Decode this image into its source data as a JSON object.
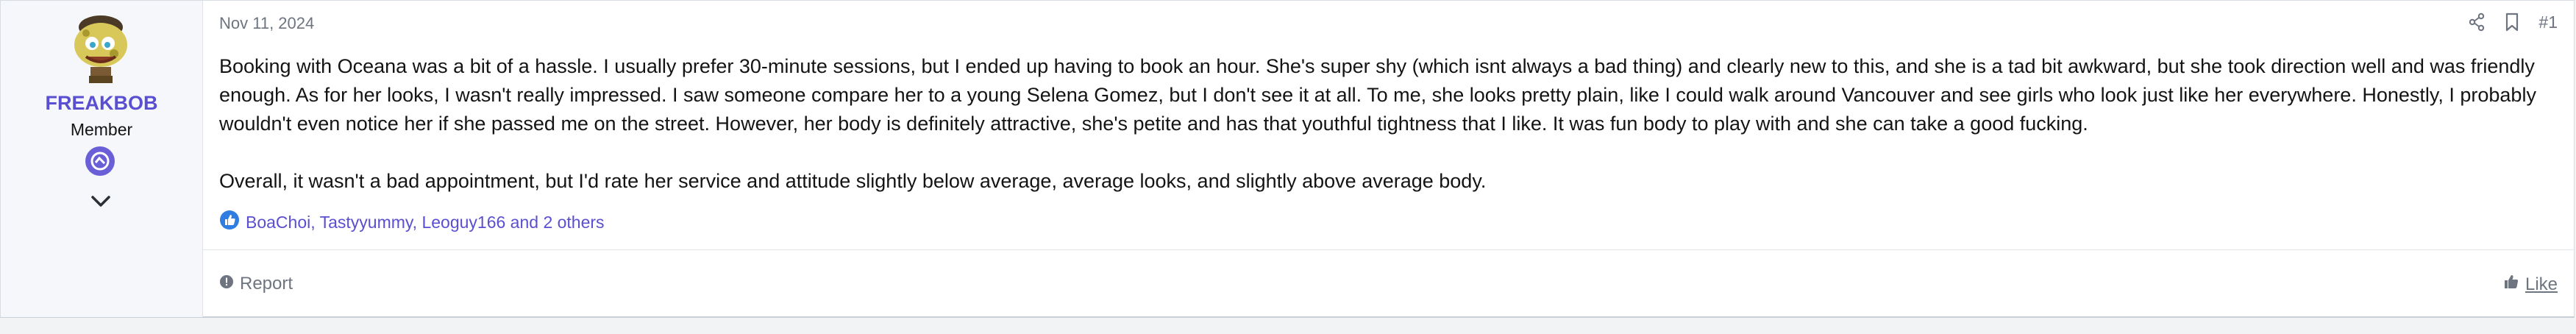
{
  "user": {
    "name": "FREAKBOB",
    "title": "Member",
    "avatar_icon": "caveman-spongebob-avatar",
    "badge_icon": "member-badge-icon",
    "name_color": "#5b4fd1"
  },
  "post": {
    "date": "Nov 11, 2024",
    "number": "#1",
    "paragraphs": [
      "Booking with Oceana was a bit of a hassle. I usually prefer 30-minute sessions, but I ended up having to book an hour. She's super shy (which isnt always a bad thing) and clearly new to this, and she is a tad bit awkward, but she took direction well and was friendly enough. As for her looks, I wasn't really impressed. I saw someone compare her to a young Selena Gomez, but I don't see it at all. To me, she looks pretty plain, like I could walk around Vancouver and see girls who look just like her everywhere. Honestly, I probably wouldn't even notice her if she passed me on the street. However, her body is definitely attractive, she's petite and has that youthful tightness that I like. It was fun body to play with and she can take a good fucking.",
      "Overall, it wasn't a bad appointment, but I'd rate her service and attitude slightly below average, average looks, and slightly above average body."
    ],
    "reactions_text": "BoaChoi, Tastyyummy, Leoguy166 and 2 others"
  },
  "footer": {
    "report_label": "Report",
    "like_label": "Like"
  },
  "icons": {
    "share": "share-icon",
    "bookmark": "bookmark-icon",
    "expand": "chevron-down-icon",
    "reaction": "thumbs-up-reaction-icon",
    "report": "alert-circle-icon",
    "like": "thumbs-up-icon"
  },
  "colors": {
    "accent": "#5b4fd1",
    "muted": "#6e7580",
    "reaction_blue": "#2f7de1"
  }
}
